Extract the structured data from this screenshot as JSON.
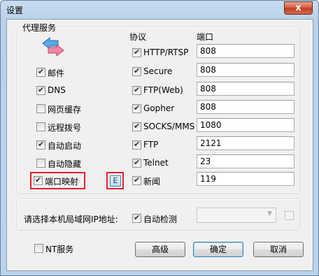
{
  "window": {
    "title": "设置",
    "close_glyph": "x"
  },
  "proxy_group": {
    "title": "代理服务",
    "left_options": [
      {
        "label": "邮件",
        "checked": true
      },
      {
        "label": "DNS",
        "checked": true
      },
      {
        "label": "网页缓存",
        "checked": false
      },
      {
        "label": "远程拨号",
        "checked": false
      },
      {
        "label": "自动启动",
        "checked": true
      },
      {
        "label": "自动隐藏",
        "checked": false
      },
      {
        "label": "端口映射",
        "checked": true
      }
    ],
    "e_button_label": "E",
    "protocol_header": "协议",
    "port_header": "端口",
    "protocols": [
      {
        "label": "HTTP/RTSP",
        "checked": true,
        "port": "808"
      },
      {
        "label": "Secure",
        "checked": true,
        "port": "808"
      },
      {
        "label": "FTP(Web)",
        "checked": true,
        "port": "808"
      },
      {
        "label": "Gopher",
        "checked": true,
        "port": "808"
      },
      {
        "label": "SOCKS/MMS",
        "checked": true,
        "port": "1080"
      },
      {
        "label": "FTP",
        "checked": true,
        "port": "2121"
      },
      {
        "label": "Telnet",
        "checked": true,
        "port": "23"
      },
      {
        "label": "新闻",
        "checked": true,
        "port": "119"
      }
    ]
  },
  "ip_group": {
    "label": "请选择本机局域网IP地址:",
    "auto_detect_label": "自动检测",
    "auto_detect_checked": true,
    "ip_select_value": ""
  },
  "footer": {
    "nt_service_label": "NT服务",
    "nt_service_checked": false,
    "advanced_label": "高级",
    "ok_label": "确定",
    "cancel_label": "取消"
  },
  "colors": {
    "highlight": "#e8202a",
    "titlebar": "#b9d1ea"
  }
}
